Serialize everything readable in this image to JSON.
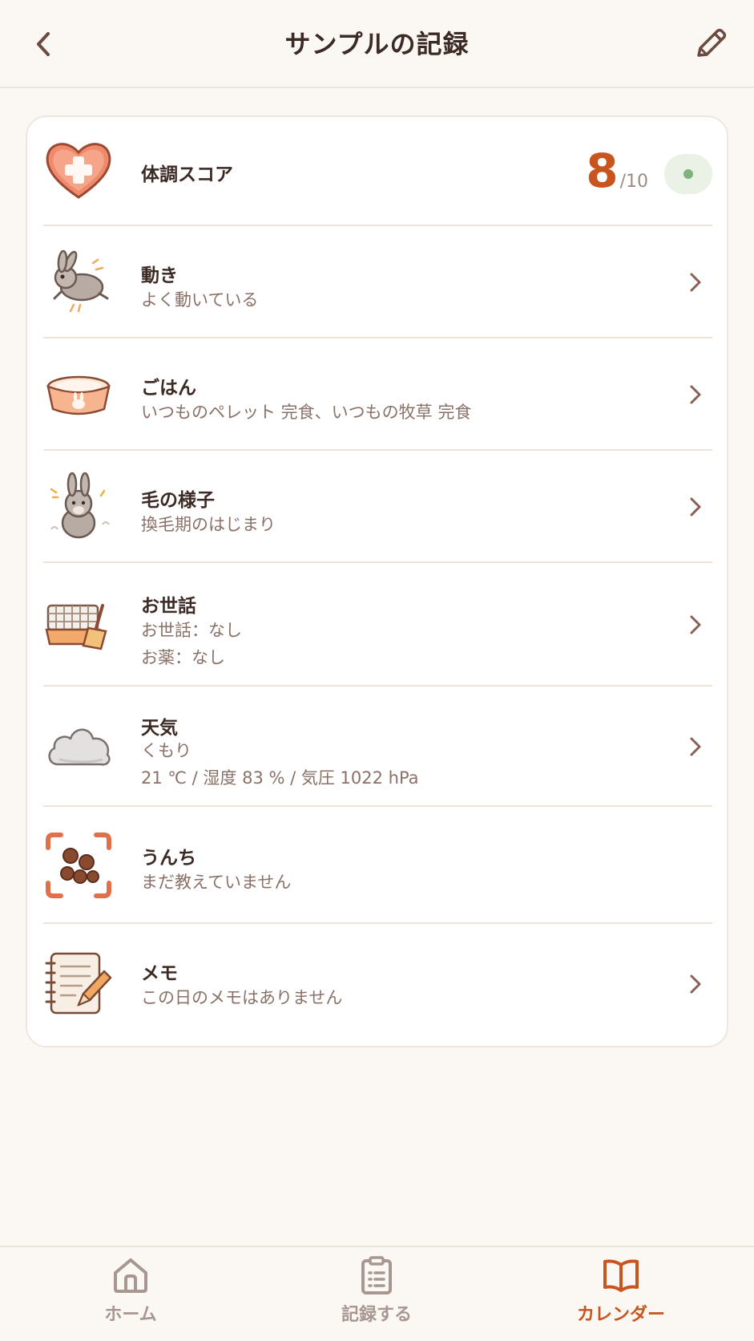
{
  "header": {
    "title": "サンプルの記録",
    "back_icon": "chevron-left-icon",
    "edit_icon": "pencil-icon"
  },
  "score_row": {
    "label": "体調スコア",
    "value": "8",
    "denominator": "/10",
    "icon": "heart-plus-icon",
    "status_color": "#7fb27f"
  },
  "rows": [
    {
      "label": "動き",
      "lines": [
        "よく動いている"
      ],
      "icon": "running-rabbit-icon"
    },
    {
      "label": "ごはん",
      "lines": [
        "いつものペレット 完食、いつもの牧草 完食"
      ],
      "icon": "food-bowl-icon"
    },
    {
      "label": "毛の様子",
      "lines": [
        "換毛期のはじまり"
      ],
      "icon": "rabbit-fur-icon"
    },
    {
      "label": "お世話",
      "lines": [
        "お世話：なし",
        "お薬：なし"
      ],
      "icon": "cage-broom-icon"
    },
    {
      "label": "天気",
      "lines": [
        "くもり",
        "21 ℃ / 湿度 83 % / 気圧 1022 hPa"
      ],
      "icon": "cloud-icon"
    },
    {
      "label": "うんち",
      "lines": [
        "まだ教えていません"
      ],
      "icon": "droppings-scan-icon"
    },
    {
      "label": "メモ",
      "lines": [
        "この日のメモはありません"
      ],
      "icon": "notepad-pencil-icon"
    }
  ],
  "tabs": [
    {
      "label": "ホーム",
      "icon": "home-icon",
      "active": false
    },
    {
      "label": "記録する",
      "icon": "clipboard-list-icon",
      "active": false
    },
    {
      "label": "カレンダー",
      "icon": "open-book-icon",
      "active": true
    }
  ],
  "colors": {
    "accent": "#c9551e",
    "background": "#fbf8f3",
    "text": "#3c2a24",
    "subtext": "#8a7168"
  }
}
